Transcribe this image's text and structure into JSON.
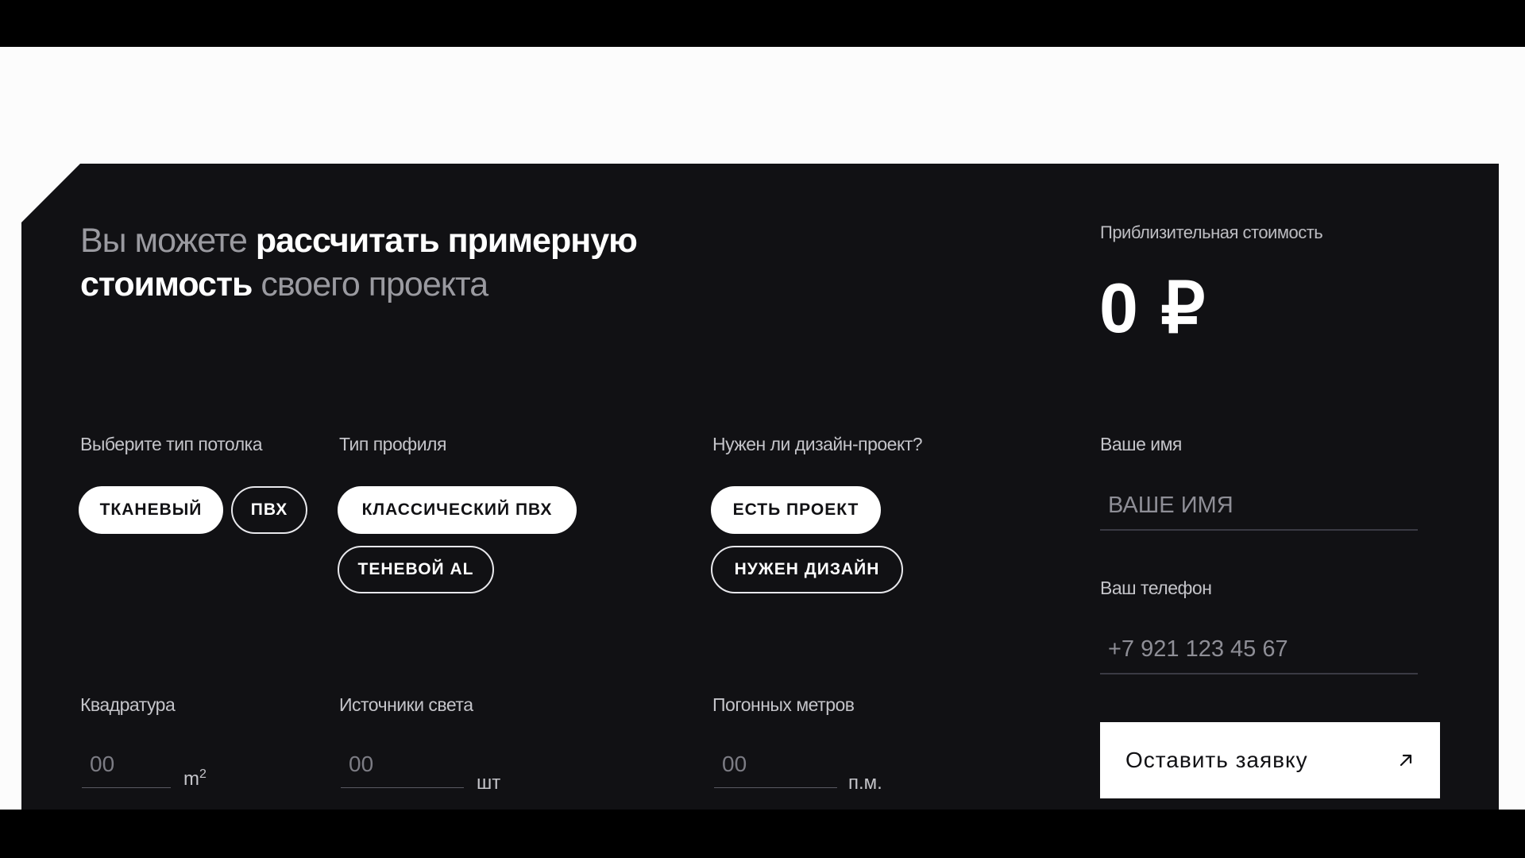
{
  "heading": {
    "part1": "Вы можете ",
    "part2": "рассчитать примерную",
    "part3": "стоимость",
    "part4": " своего проекта"
  },
  "cost": {
    "label": "Приблизительная стоимость",
    "value": "0 ₽"
  },
  "ceiling_type": {
    "label": "Выберите тип потолка",
    "options": [
      "ТКАНЕВЫЙ",
      "ПВХ"
    ],
    "selected": "ТКАНЕВЫЙ"
  },
  "profile_type": {
    "label": "Тип профиля",
    "options": [
      "КЛАССИЧЕСКИЙ ПВХ",
      "ТЕНЕВОЙ AL"
    ],
    "selected": "КЛАССИЧЕСКИЙ ПВХ"
  },
  "design_project": {
    "label": "Нужен ли дизайн-проект?",
    "options": [
      "ЕСТЬ ПРОЕКТ",
      "НУЖЕН ДИЗАЙН"
    ],
    "selected": "ЕСТЬ ПРОЕКТ"
  },
  "area": {
    "label": "Квадратура",
    "placeholder": "00",
    "unit": "m",
    "unit_sup": "2"
  },
  "lights": {
    "label": "Источники света",
    "placeholder": "00",
    "unit": "шт"
  },
  "linear_meters": {
    "label": "Погонных метров",
    "placeholder": "00",
    "unit": "п.м."
  },
  "name_field": {
    "label": "Ваше имя",
    "placeholder": "ВАШЕ ИМЯ"
  },
  "phone_field": {
    "label": "Ваш телефон",
    "placeholder": "+7 921 123 45 67"
  },
  "submit": {
    "label": "Оставить заявку",
    "icon": "arrow-up-right-icon"
  },
  "colors": {
    "panel": "#111114",
    "accent": "#ffffff",
    "page": "#fcfcfc"
  }
}
